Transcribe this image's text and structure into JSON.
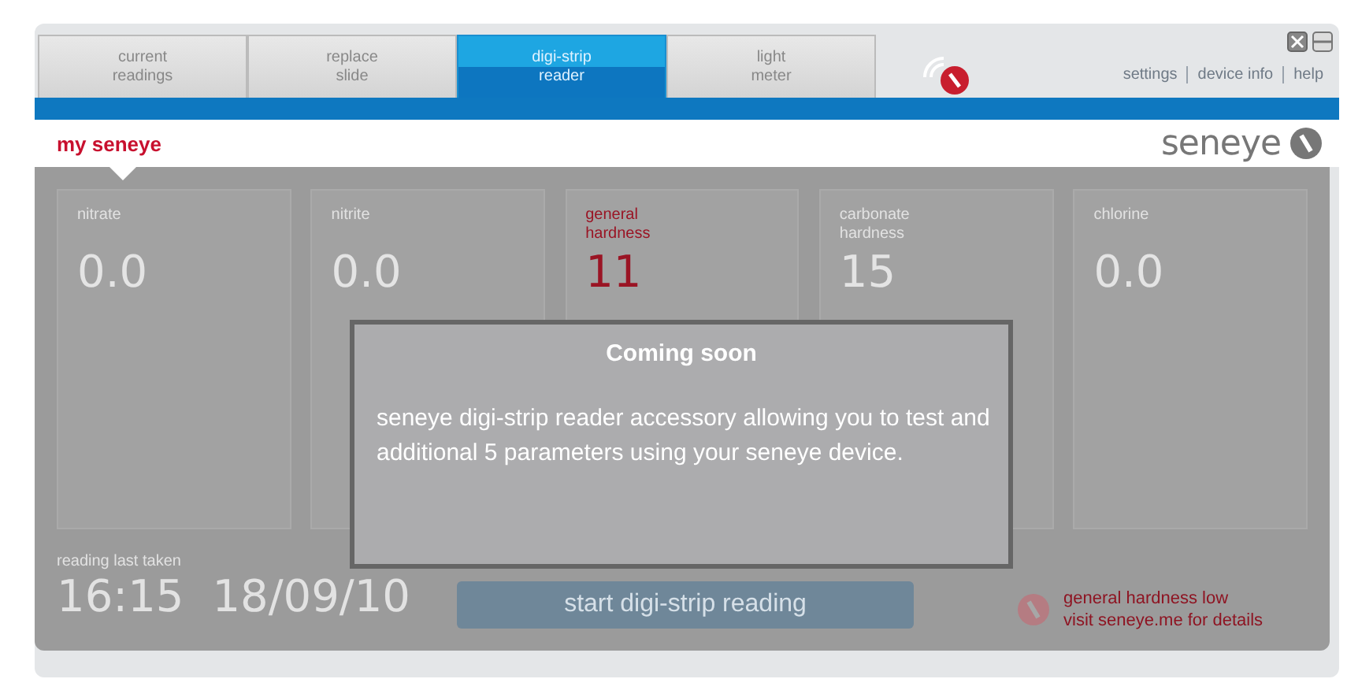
{
  "tabs": [
    {
      "label": "current\nreadings",
      "selected": false
    },
    {
      "label": "replace\nslide",
      "selected": false
    },
    {
      "label": "digi-strip\nreader",
      "selected": true
    },
    {
      "label": "light\nmeter",
      "selected": false
    }
  ],
  "top_links": [
    "settings",
    "device info",
    "help"
  ],
  "header": {
    "title": "my seneye",
    "logo": "seneye"
  },
  "cards": [
    {
      "label": "nitrate",
      "value": "0.0",
      "alert": false
    },
    {
      "label": "nitrite",
      "value": "0.0",
      "alert": false
    },
    {
      "label": "general\nhardness",
      "value": "11",
      "alert": true
    },
    {
      "label": "carbonate\nhardness",
      "value": "15",
      "alert": false
    },
    {
      "label": "chlorine",
      "value": "0.0",
      "alert": false
    }
  ],
  "last_reading": {
    "label": "reading last taken",
    "time": "16:15",
    "date": "18/09/10"
  },
  "start_button": "start digi-strip reading",
  "warning": {
    "lines": [
      "general hardness low",
      "visit seneye.me for details"
    ]
  },
  "modal": {
    "title": "Coming soon",
    "body": "seneye digi-strip reader accessory allowing you to test and additional 5 parameters using your seneye device."
  }
}
